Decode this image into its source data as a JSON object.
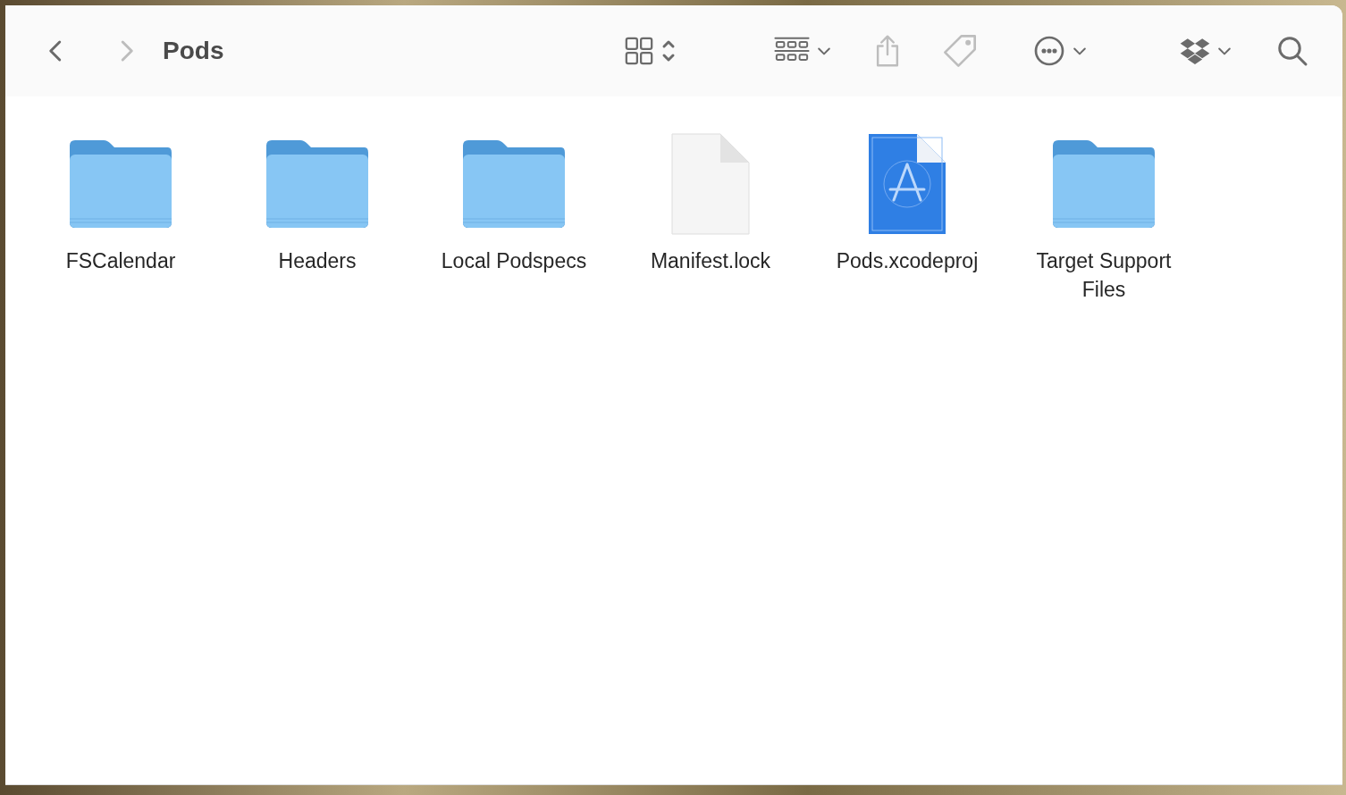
{
  "window": {
    "title": "Pods"
  },
  "toolbar": {
    "back": {
      "disabled": false
    },
    "forward": {
      "disabled": true
    },
    "share": {
      "disabled": true
    },
    "tags": {
      "disabled": true
    }
  },
  "items": [
    {
      "name": "FSCalendar",
      "kind": "folder"
    },
    {
      "name": "Headers",
      "kind": "folder"
    },
    {
      "name": "Local Podspecs",
      "kind": "folder"
    },
    {
      "name": "Manifest.lock",
      "kind": "document"
    },
    {
      "name": "Pods.xcodeproj",
      "kind": "project"
    },
    {
      "name": "Target Support Files",
      "kind": "folder"
    }
  ]
}
